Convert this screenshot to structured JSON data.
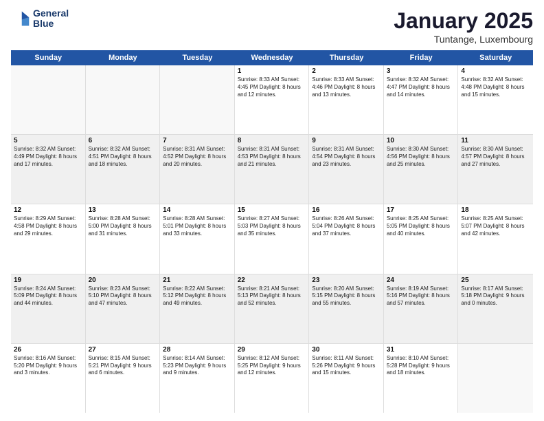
{
  "header": {
    "logo_line1": "General",
    "logo_line2": "Blue",
    "month": "January 2025",
    "location": "Tuntange, Luxembourg"
  },
  "weekdays": [
    "Sunday",
    "Monday",
    "Tuesday",
    "Wednesday",
    "Thursday",
    "Friday",
    "Saturday"
  ],
  "rows": [
    [
      {
        "day": "",
        "text": "",
        "empty": true
      },
      {
        "day": "",
        "text": "",
        "empty": true
      },
      {
        "day": "",
        "text": "",
        "empty": true
      },
      {
        "day": "1",
        "text": "Sunrise: 8:33 AM\nSunset: 4:45 PM\nDaylight: 8 hours\nand 12 minutes."
      },
      {
        "day": "2",
        "text": "Sunrise: 8:33 AM\nSunset: 4:46 PM\nDaylight: 8 hours\nand 13 minutes."
      },
      {
        "day": "3",
        "text": "Sunrise: 8:32 AM\nSunset: 4:47 PM\nDaylight: 8 hours\nand 14 minutes."
      },
      {
        "day": "4",
        "text": "Sunrise: 8:32 AM\nSunset: 4:48 PM\nDaylight: 8 hours\nand 15 minutes."
      }
    ],
    [
      {
        "day": "5",
        "text": "Sunrise: 8:32 AM\nSunset: 4:49 PM\nDaylight: 8 hours\nand 17 minutes."
      },
      {
        "day": "6",
        "text": "Sunrise: 8:32 AM\nSunset: 4:51 PM\nDaylight: 8 hours\nand 18 minutes."
      },
      {
        "day": "7",
        "text": "Sunrise: 8:31 AM\nSunset: 4:52 PM\nDaylight: 8 hours\nand 20 minutes."
      },
      {
        "day": "8",
        "text": "Sunrise: 8:31 AM\nSunset: 4:53 PM\nDaylight: 8 hours\nand 21 minutes."
      },
      {
        "day": "9",
        "text": "Sunrise: 8:31 AM\nSunset: 4:54 PM\nDaylight: 8 hours\nand 23 minutes."
      },
      {
        "day": "10",
        "text": "Sunrise: 8:30 AM\nSunset: 4:56 PM\nDaylight: 8 hours\nand 25 minutes."
      },
      {
        "day": "11",
        "text": "Sunrise: 8:30 AM\nSunset: 4:57 PM\nDaylight: 8 hours\nand 27 minutes."
      }
    ],
    [
      {
        "day": "12",
        "text": "Sunrise: 8:29 AM\nSunset: 4:58 PM\nDaylight: 8 hours\nand 29 minutes."
      },
      {
        "day": "13",
        "text": "Sunrise: 8:28 AM\nSunset: 5:00 PM\nDaylight: 8 hours\nand 31 minutes."
      },
      {
        "day": "14",
        "text": "Sunrise: 8:28 AM\nSunset: 5:01 PM\nDaylight: 8 hours\nand 33 minutes."
      },
      {
        "day": "15",
        "text": "Sunrise: 8:27 AM\nSunset: 5:03 PM\nDaylight: 8 hours\nand 35 minutes."
      },
      {
        "day": "16",
        "text": "Sunrise: 8:26 AM\nSunset: 5:04 PM\nDaylight: 8 hours\nand 37 minutes."
      },
      {
        "day": "17",
        "text": "Sunrise: 8:25 AM\nSunset: 5:05 PM\nDaylight: 8 hours\nand 40 minutes."
      },
      {
        "day": "18",
        "text": "Sunrise: 8:25 AM\nSunset: 5:07 PM\nDaylight: 8 hours\nand 42 minutes."
      }
    ],
    [
      {
        "day": "19",
        "text": "Sunrise: 8:24 AM\nSunset: 5:09 PM\nDaylight: 8 hours\nand 44 minutes."
      },
      {
        "day": "20",
        "text": "Sunrise: 8:23 AM\nSunset: 5:10 PM\nDaylight: 8 hours\nand 47 minutes."
      },
      {
        "day": "21",
        "text": "Sunrise: 8:22 AM\nSunset: 5:12 PM\nDaylight: 8 hours\nand 49 minutes."
      },
      {
        "day": "22",
        "text": "Sunrise: 8:21 AM\nSunset: 5:13 PM\nDaylight: 8 hours\nand 52 minutes."
      },
      {
        "day": "23",
        "text": "Sunrise: 8:20 AM\nSunset: 5:15 PM\nDaylight: 8 hours\nand 55 minutes."
      },
      {
        "day": "24",
        "text": "Sunrise: 8:19 AM\nSunset: 5:16 PM\nDaylight: 8 hours\nand 57 minutes."
      },
      {
        "day": "25",
        "text": "Sunrise: 8:17 AM\nSunset: 5:18 PM\nDaylight: 9 hours\nand 0 minutes."
      }
    ],
    [
      {
        "day": "26",
        "text": "Sunrise: 8:16 AM\nSunset: 5:20 PM\nDaylight: 9 hours\nand 3 minutes."
      },
      {
        "day": "27",
        "text": "Sunrise: 8:15 AM\nSunset: 5:21 PM\nDaylight: 9 hours\nand 6 minutes."
      },
      {
        "day": "28",
        "text": "Sunrise: 8:14 AM\nSunset: 5:23 PM\nDaylight: 9 hours\nand 9 minutes."
      },
      {
        "day": "29",
        "text": "Sunrise: 8:12 AM\nSunset: 5:25 PM\nDaylight: 9 hours\nand 12 minutes."
      },
      {
        "day": "30",
        "text": "Sunrise: 8:11 AM\nSunset: 5:26 PM\nDaylight: 9 hours\nand 15 minutes."
      },
      {
        "day": "31",
        "text": "Sunrise: 8:10 AM\nSunset: 5:28 PM\nDaylight: 9 hours\nand 18 minutes."
      },
      {
        "day": "",
        "text": "",
        "empty": true
      }
    ]
  ]
}
